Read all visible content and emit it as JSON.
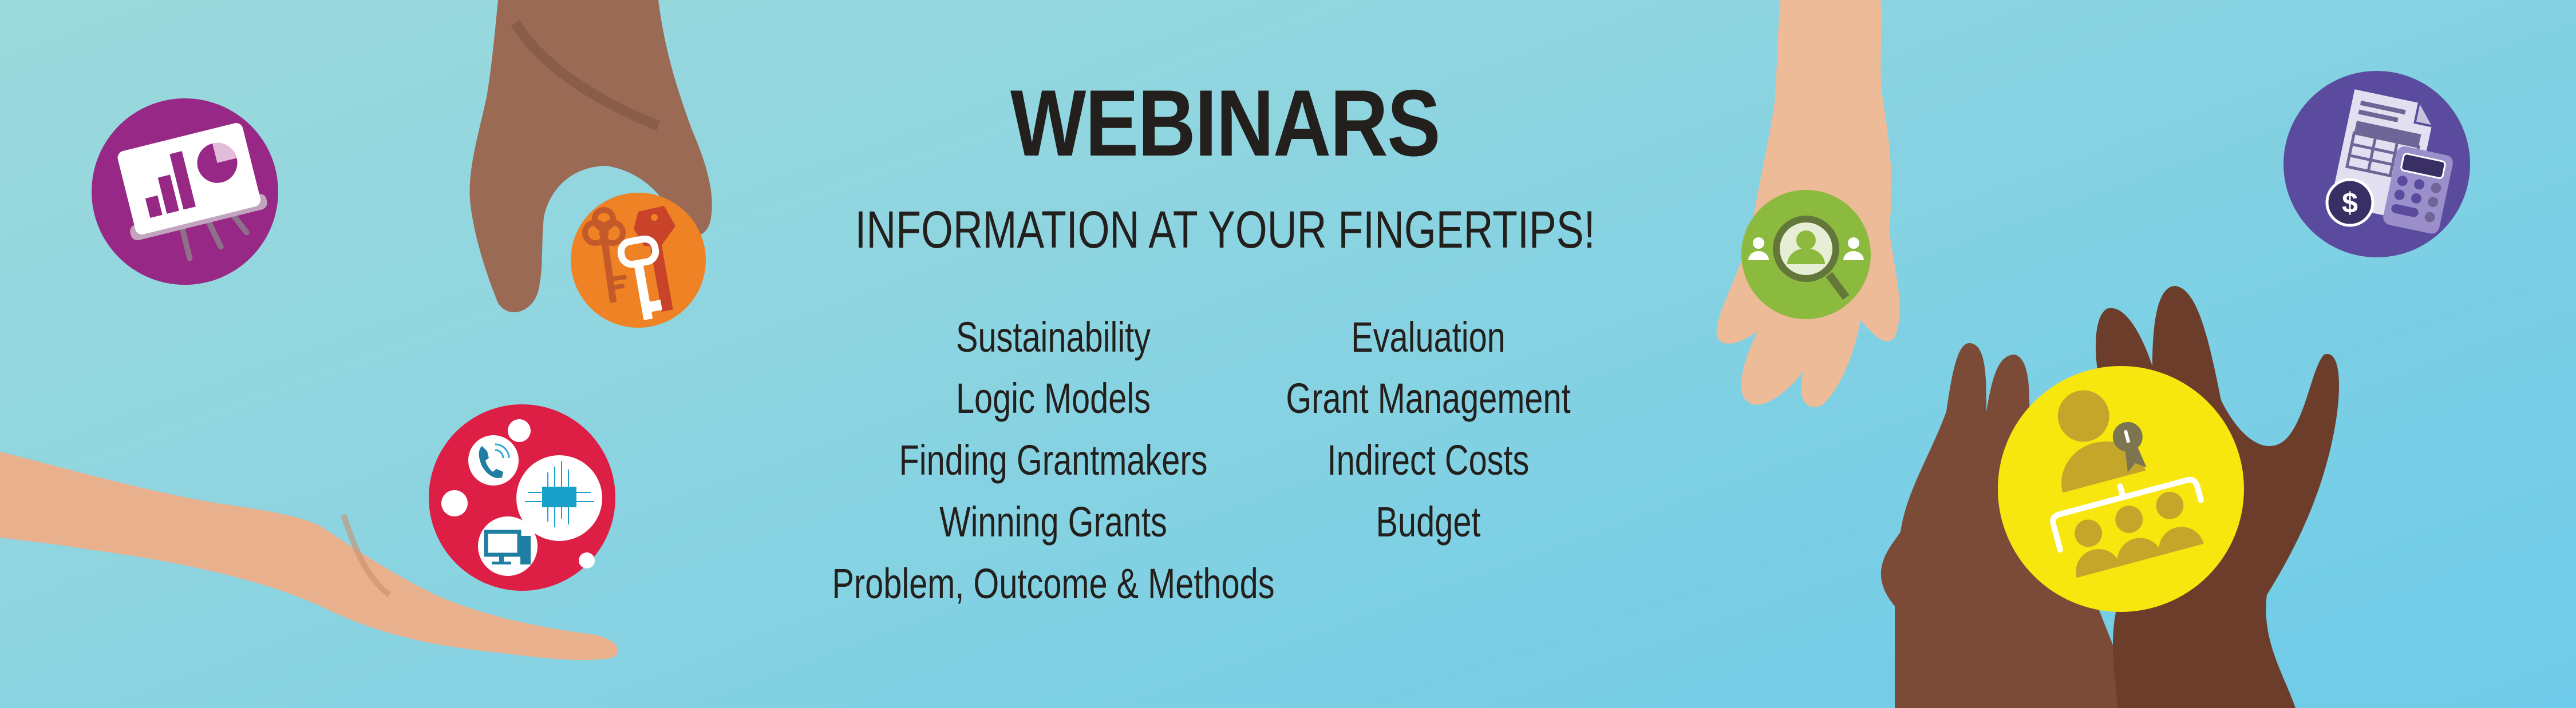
{
  "banner": {
    "title": "WEBINARS",
    "subtitle": "INFORMATION AT YOUR FINGERTIPS!",
    "background_colors": [
      "#9bd9dc",
      "#6ecbe9"
    ]
  },
  "topics": {
    "left": [
      "Sustainability",
      "Logic Models",
      "Finding Grantmakers",
      "Winning Grants",
      "Problem, Outcome & Methods"
    ],
    "right": [
      "Evaluation",
      "Grant Management",
      "Indirect Costs",
      "Budget"
    ]
  },
  "icons": {
    "presentation": {
      "name": "presentation-chart-icon",
      "color": "#982885"
    },
    "keys": {
      "name": "keys-icon",
      "color": "#ee8224"
    },
    "technology": {
      "name": "technology-icon",
      "color": "#de1f45"
    },
    "people_search": {
      "name": "people-search-icon",
      "color": "#8cba3f"
    },
    "budget_calculator": {
      "name": "budget-calculator-icon",
      "color": "#5b4b9f",
      "symbol": "$"
    },
    "organization": {
      "name": "organization-chart-icon",
      "color": "#f8e70e"
    }
  }
}
